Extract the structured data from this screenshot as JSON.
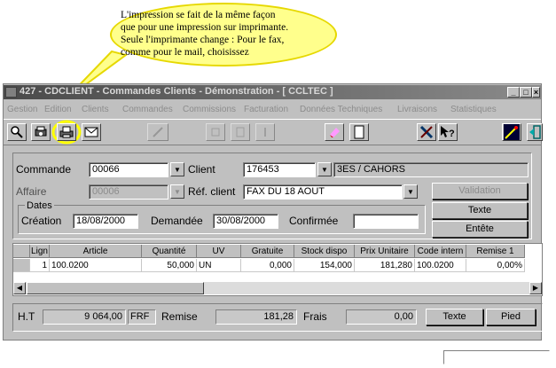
{
  "callout": {
    "lines": [
      "L'impression  se fait de la même façon",
      "que pour une impression sur imprimante.",
      "Seule l'imprimante change : Pour le fax,",
      "comme pour le mail, choisissez"
    ]
  },
  "window": {
    "title": "427 - CDCLIENT - Commandes Clients - Démonstration - [ CCLTEC ]",
    "min": "_",
    "max": "□",
    "close": "×"
  },
  "menu": [
    "Gestion",
    "Edition",
    "Clients",
    "Commandes",
    "Commissions",
    "Facturation",
    "Données Techniques",
    "Livraisons",
    "Statistiques"
  ],
  "toolbar": {
    "icons": [
      "preview-icon",
      "print-preview-icon",
      "print-icon",
      "mail-icon",
      "disabled-icon",
      "disabled-icon",
      "disabled-icon",
      "disabled-icon",
      "eraser-icon",
      "new-document-icon",
      "tools-icon",
      "help-icon",
      "wizard-icon",
      "exit-icon"
    ]
  },
  "form": {
    "commande_label": "Commande",
    "commande_value": "00066",
    "client_label": "Client",
    "client_code": "176453",
    "client_name": "3ES / CAHORS",
    "affaire_label": "Affaire",
    "affaire_value": "00006",
    "ref_client_label": "Réf. client",
    "ref_client_value": "FAX DU 18 AOUT",
    "dates_label": "Dates",
    "creation_label": "Création",
    "creation_value": "18/08/2000",
    "demandee_label": "Demandée",
    "demandee_value": "30/08/2000",
    "confirmee_label": "Confirmée",
    "confirmee_value": "",
    "validation_button": "Validation",
    "texte_button": "Texte",
    "entete_button": "Entête"
  },
  "grid": {
    "columns": [
      "Lign",
      "Article",
      "Quantité",
      "UV",
      "Gratuite",
      "Stock dispo",
      "Prix Unitaire",
      "Code intern",
      "Remise 1"
    ],
    "rows": [
      [
        "1",
        "100.0200",
        "50,000",
        "UN",
        "0,000",
        "154,000",
        "181,280",
        "100.0200",
        "0,00%"
      ]
    ]
  },
  "totals": {
    "ht_label": "H.T",
    "ht_value": "9 064,00",
    "currency": "FRF",
    "remise_label": "Remise",
    "remise_value": "181,28",
    "frais_label": "Frais",
    "frais_value": "0,00",
    "texte_button": "Texte",
    "pied_button": "Pied"
  },
  "colors": {
    "callout_fill": "#ffff8c",
    "callout_border": "#e6d800",
    "window_face": "#c0c0c0",
    "print_highlight": "#ffff00"
  }
}
